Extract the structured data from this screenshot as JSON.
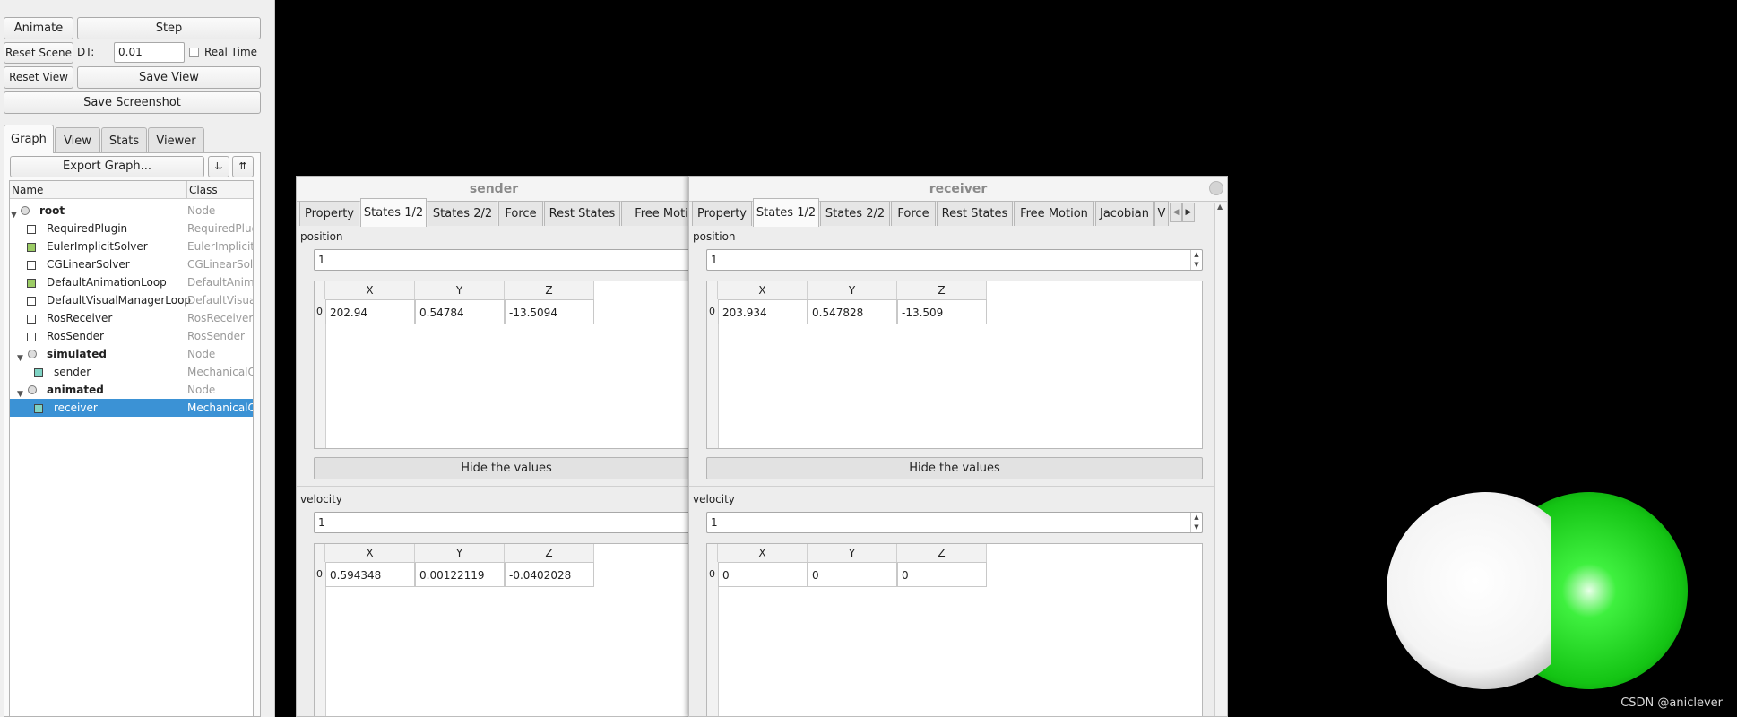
{
  "toolbar": {
    "animate": "Animate",
    "step": "Step",
    "reset_scene": "Reset Scene",
    "dt_label": "DT:",
    "dt_value": "0.01",
    "real_time": "Real Time",
    "reset_view": "Reset View",
    "save_view": "Save View",
    "save_screenshot": "Save Screenshot"
  },
  "tabs": [
    "Graph",
    "View",
    "Stats",
    "Viewer"
  ],
  "graph": {
    "export_button": "Export Graph...",
    "columns": [
      "Name",
      "Class"
    ],
    "rows": [
      {
        "name": "root",
        "class": "Node"
      },
      {
        "name": "RequiredPlugin",
        "class": "RequiredPlug"
      },
      {
        "name": "EulerImplicitSolver",
        "class": "EulerImplicitS"
      },
      {
        "name": "CGLinearSolver",
        "class": "CGLinearSolv"
      },
      {
        "name": "DefaultAnimationLoop",
        "class": "DefaultAnima"
      },
      {
        "name": "DefaultVisualManagerLoop",
        "class": "DefaultVisual"
      },
      {
        "name": "RosReceiver",
        "class": "RosReceiver"
      },
      {
        "name": "RosSender",
        "class": "RosSender"
      },
      {
        "name": "simulated",
        "class": "Node"
      },
      {
        "name": "sender",
        "class": "MechanicalOl"
      },
      {
        "name": "animated",
        "class": "Node"
      },
      {
        "name": "receiver",
        "class": "MechanicalOl"
      }
    ]
  },
  "sender": {
    "title": "sender",
    "tabs": [
      "Property",
      "States 1/2",
      "States 2/2",
      "Force",
      "Rest States",
      "Free Moti"
    ],
    "position_label": "position",
    "position_count": "1",
    "columns": [
      "X",
      "Y",
      "Z"
    ],
    "position_row": {
      "index": "0",
      "x": "202.94",
      "y": "0.54784",
      "z": "-13.5094"
    },
    "hide_values": "Hide the values",
    "velocity_label": "velocity",
    "velocity_count": "1",
    "velocity_row": {
      "index": "0",
      "x": "0.594348",
      "y": "0.00122119",
      "z": "-0.0402028"
    }
  },
  "receiver": {
    "title": "receiver",
    "tabs": [
      "Property",
      "States 1/2",
      "States 2/2",
      "Force",
      "Rest States",
      "Free Motion",
      "Jacobian",
      "V"
    ],
    "position_label": "position",
    "position_count": "1",
    "columns": [
      "X",
      "Y",
      "Z"
    ],
    "position_row": {
      "index": "0",
      "x": "203.934",
      "y": "0.547828",
      "z": "-13.509"
    },
    "hide_values": "Hide the values",
    "velocity_label": "velocity",
    "velocity_count": "1",
    "velocity_row": {
      "index": "0",
      "x": "0",
      "y": "0",
      "z": "0"
    }
  },
  "watermark": "CSDN @aniclever",
  "colors": {
    "selection": "#3b92d5",
    "sphere_green": "#1fd41f",
    "sphere_white": "#ffffff",
    "obj_icon_green": "#9ccc65",
    "obj_icon_teal": "#7fd3c4"
  }
}
